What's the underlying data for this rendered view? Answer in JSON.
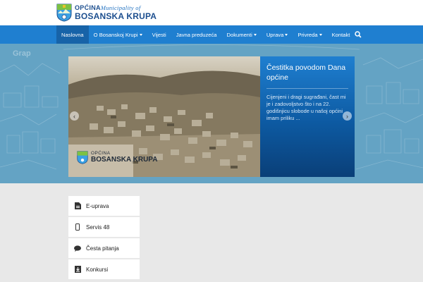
{
  "header": {
    "logo_line1": "OPĆINA",
    "logo_line1_sub": "Municipality of",
    "logo_line2": "BOSANSKA KRUPA"
  },
  "nav": {
    "items": [
      {
        "label": "Naslovna",
        "active": true,
        "dropdown": false
      },
      {
        "label": "O Bosanskoj Krupi",
        "active": false,
        "dropdown": true
      },
      {
        "label": "Vijesti",
        "active": false,
        "dropdown": false
      },
      {
        "label": "Javna preduzeća",
        "active": false,
        "dropdown": false
      },
      {
        "label": "Dokumenti",
        "active": false,
        "dropdown": true
      },
      {
        "label": "Uprava",
        "active": false,
        "dropdown": true
      },
      {
        "label": "Privreda",
        "active": false,
        "dropdown": true
      },
      {
        "label": "Kontakt",
        "active": false,
        "dropdown": false
      }
    ],
    "search_icon": "search-icon"
  },
  "hero": {
    "corner_word": "Grap",
    "slide": {
      "title": "Čestitka povodom Dana općine",
      "excerpt": "Cijenjeni i dragi sugrađani, čast mi je i zadovoljstvo što i na 22. godišnjicu slobode u našoj općini imam priliku ...",
      "image_logo_line1": "OPĆINA",
      "image_logo_line2": "BOSANSKA KRUPA"
    },
    "prev_icon": "chevron-left-icon",
    "next_icon": "chevron-right-icon"
  },
  "side_menu": {
    "items": [
      {
        "label": "E-uprava",
        "icon": "document-icon"
      },
      {
        "label": "Servis 48",
        "icon": "mobile-icon"
      },
      {
        "label": "Česta pitanja",
        "icon": "chat-icon"
      },
      {
        "label": "Konkursi",
        "icon": "download-icon"
      }
    ]
  },
  "colors": {
    "nav_blue": "#1f7fd0",
    "nav_active": "#1763a8",
    "hero_bg": "#5f9fbf",
    "panel_dark": "#0a3f78",
    "page_bg": "#e8e8e8"
  }
}
